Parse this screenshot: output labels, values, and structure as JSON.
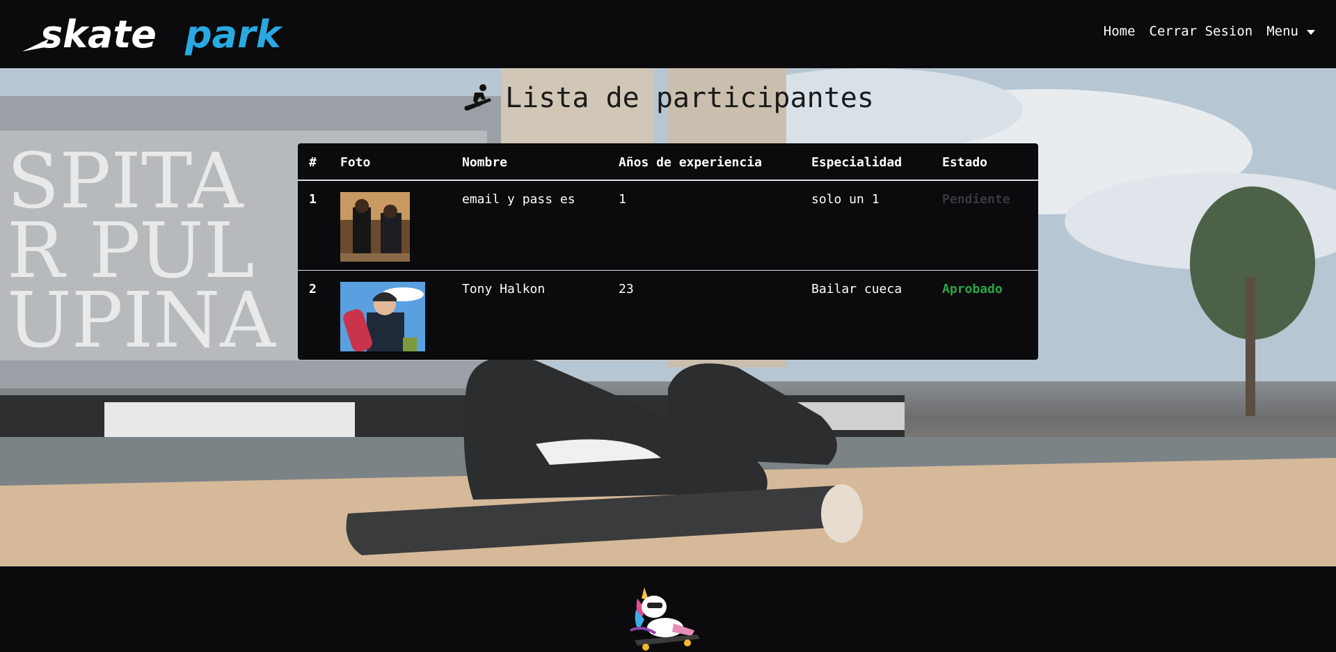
{
  "navbar": {
    "logo_text_part1": "skate",
    "logo_text_part2": "park",
    "links": [
      {
        "label": "Home"
      },
      {
        "label": "Cerrar Sesion"
      },
      {
        "label": "Menu"
      }
    ]
  },
  "page": {
    "title": "Lista de participantes",
    "title_icon": "snowboarding-icon"
  },
  "table": {
    "headers": [
      "#",
      "Foto",
      "Nombre",
      "Años de experiencia",
      "Especialidad",
      "Estado"
    ],
    "rows": [
      {
        "num": "1",
        "photo": "participant-photo",
        "nombre": "email y pass es",
        "experiencia": "1",
        "especialidad": "solo un 1",
        "estado": "Pendiente"
      },
      {
        "num": "2",
        "photo": "participant-photo",
        "nombre": "Tony Halkon",
        "experiencia": "23",
        "especialidad": "Bailar cueca",
        "estado": "Aprobado"
      }
    ]
  },
  "footer": {
    "mascot": "unicorn-skater-icon"
  },
  "colors": {
    "background": "#0b0a0c",
    "logo_accent": "#29a9e1",
    "status_pending": "#343a40",
    "status_approved": "#28a745"
  }
}
